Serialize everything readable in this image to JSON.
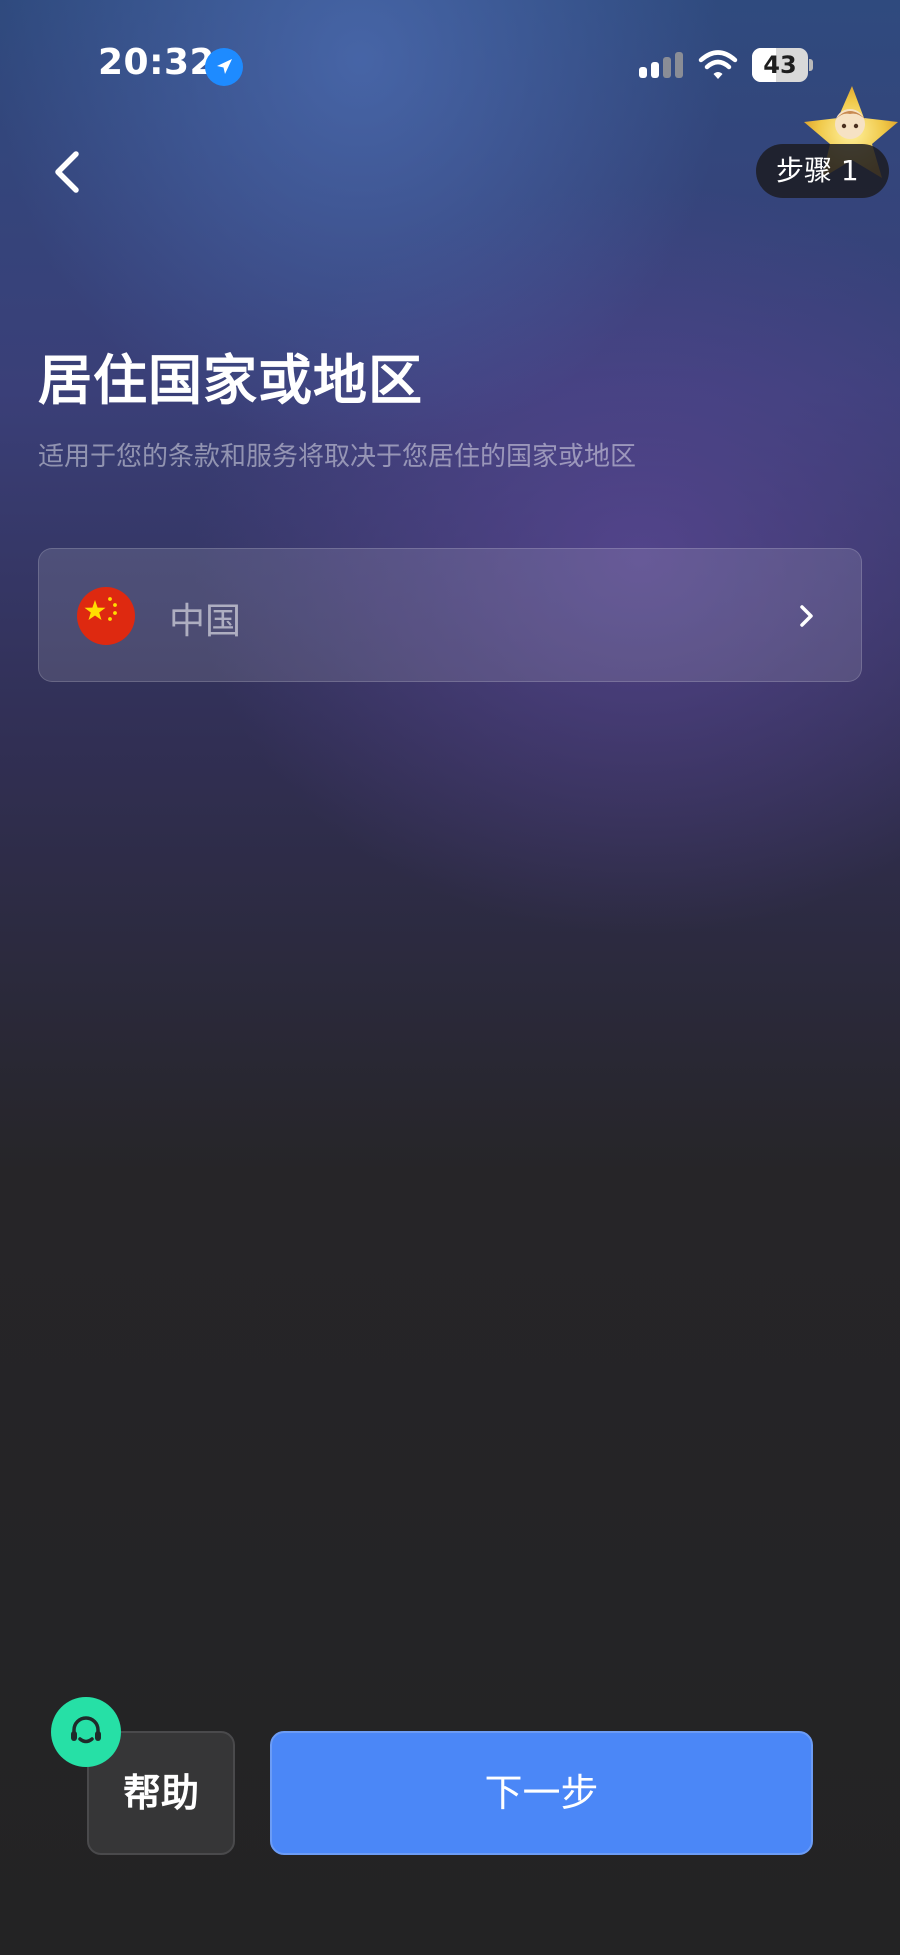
{
  "status_bar": {
    "time": "20:32",
    "battery_level": "43",
    "battery_fraction": 0.43,
    "location_icon": "location-arrow-icon",
    "signal_icon": "cellular-signal-icon",
    "wifi_icon": "wifi-icon"
  },
  "nav": {
    "back_icon": "chevron-left-icon",
    "step_label": "步骤 1"
  },
  "page": {
    "title": "居住国家或地区",
    "subtitle": "适用于您的条款和服务将取决于您居住的国家或地区"
  },
  "country_selector": {
    "flag_icon": "china-flag-icon",
    "value": "中国",
    "chevron_icon": "chevron-right-icon"
  },
  "footer": {
    "help_label": "帮助",
    "support_icon": "headset-icon",
    "next_label": "下一步"
  },
  "colors": {
    "primary": "#4b87f7",
    "support": "#26e0a6",
    "background": "#232324",
    "flag_red": "#de2910",
    "flag_yellow": "#ffde00"
  }
}
